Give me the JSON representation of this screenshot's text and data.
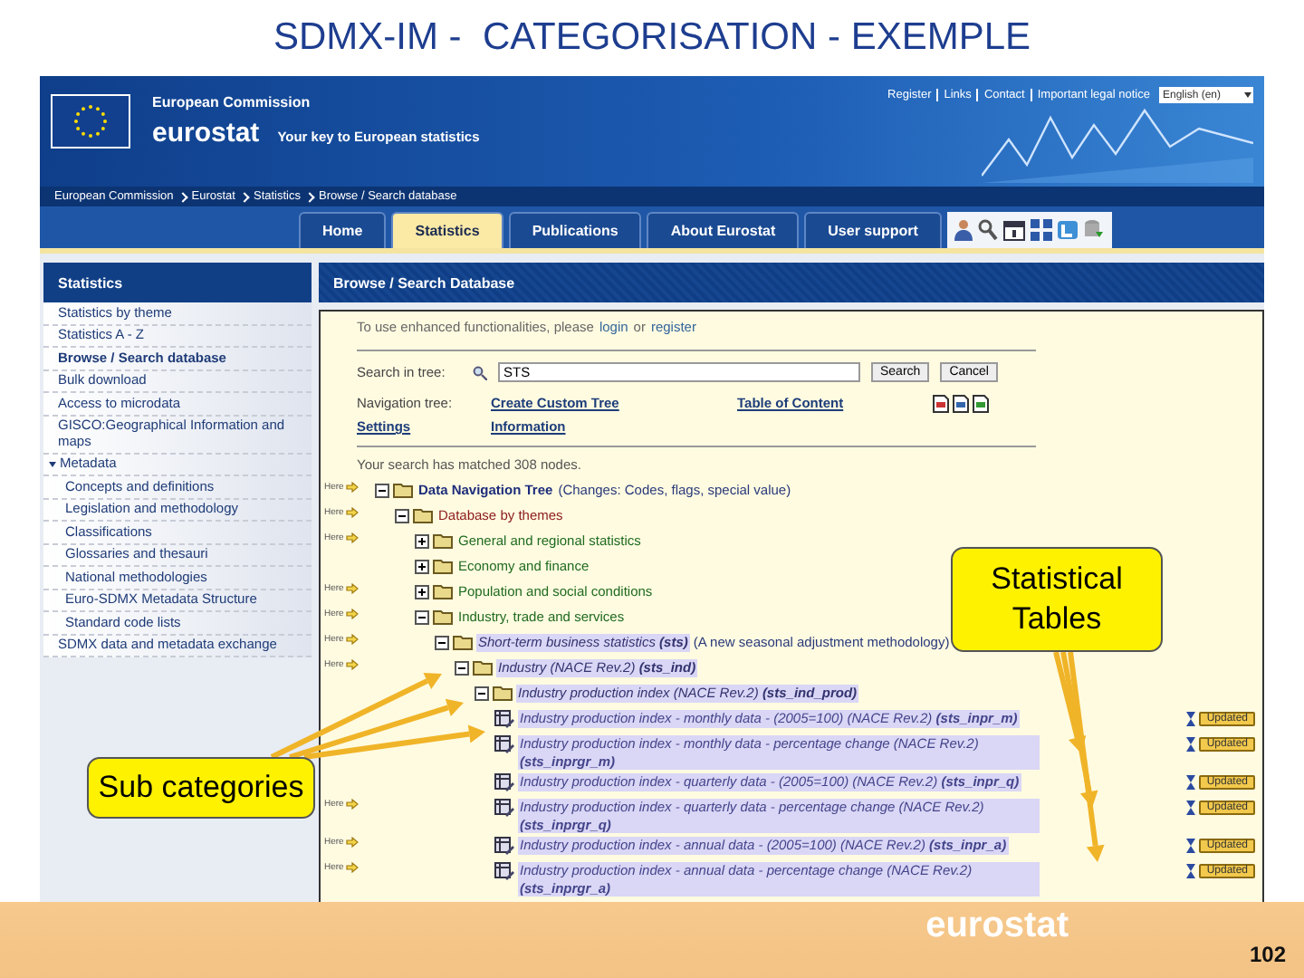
{
  "slide": {
    "title": "SDMX-IM -  CATEGORISATION - EXEMPLE",
    "page_number": "102",
    "footer_logo": "eurostat"
  },
  "site": {
    "top_links": [
      "Register",
      "Links",
      "Contact",
      "Important legal notice"
    ],
    "language": "English (en)",
    "org": "European Commission",
    "brand": "eurostat",
    "tagline": "Your key to European statistics",
    "breadcrumb": [
      "European Commission",
      "Eurostat",
      "Statistics",
      "Browse / Search database"
    ],
    "nav_tabs": [
      {
        "label": "Home",
        "selected": false
      },
      {
        "label": "Statistics",
        "selected": true
      },
      {
        "label": "Publications",
        "selected": false
      },
      {
        "label": "About Eurostat",
        "selected": false
      },
      {
        "label": "User support",
        "selected": false
      }
    ]
  },
  "sidebar": {
    "title": "Statistics",
    "items": [
      {
        "label": "Statistics by theme",
        "selected": false
      },
      {
        "label": "Statistics A - Z",
        "selected": false
      },
      {
        "label": "Browse / Search database",
        "selected": true
      },
      {
        "label": "Bulk download",
        "selected": false
      },
      {
        "label": "Access to microdata",
        "selected": false
      },
      {
        "label": "GISCO:Geographical Information and maps",
        "selected": false
      },
      {
        "label": "Metadata",
        "selected": false,
        "expanded": true,
        "children": [
          {
            "label": "Concepts and definitions",
            "selected": false
          },
          {
            "label": "Legislation and methodology",
            "selected": false
          },
          {
            "label": "Classifications",
            "selected": false
          },
          {
            "label": "Glossaries and thesauri",
            "selected": false
          },
          {
            "label": "National methodologies",
            "selected": false
          },
          {
            "label": "Euro-SDMX Metadata Structure",
            "selected": false
          },
          {
            "label": "Standard code lists",
            "selected": false
          }
        ]
      },
      {
        "label": "SDMX data and metadata exchange",
        "selected": false
      }
    ]
  },
  "main": {
    "title": "Browse / Search Database",
    "notice": [
      {
        "text": "To use enhanced functionalities, please",
        "link": false
      },
      {
        "text": "login",
        "link": true
      },
      {
        "text": "or",
        "link": false
      },
      {
        "text": "register",
        "link": true
      }
    ],
    "search": {
      "label": "Search in tree:",
      "value": "STS",
      "buttons": [
        "Search",
        "Cancel"
      ]
    },
    "navigation": {
      "label": "Navigation tree:",
      "links": [
        "Create Custom Tree",
        "Table of Content",
        "Settings",
        "Information"
      ]
    },
    "match_text": "Your search has matched 308 nodes.",
    "tree": [
      {
        "kind": "root",
        "label": "Data Navigation Tree",
        "note": "(Changes: Codes, flags, special value)",
        "here": "Here",
        "expanded": true,
        "highlighted": false,
        "children": [
          {
            "kind": "group",
            "label": "Database by themes",
            "here": "Here",
            "expanded": true,
            "highlighted": false,
            "children": [
              {
                "kind": "theme",
                "label": "General and regional statistics",
                "here": "Here",
                "expanded": false,
                "highlighted": false
              },
              {
                "kind": "theme",
                "label": "Economy and finance",
                "expanded": false,
                "highlighted": false
              },
              {
                "kind": "theme",
                "label": "Population and social conditions",
                "here": "Here",
                "expanded": false,
                "highlighted": false
              },
              {
                "kind": "theme",
                "label": "Industry, trade and services",
                "here": "Here",
                "expanded": true,
                "highlighted": false,
                "children": [
                  {
                    "kind": "folder",
                    "label": "Short-term business statistics",
                    "code": "(sts)",
                    "note": "(A new seasonal adjustment methodology)",
                    "here": "Here",
                    "expanded": true,
                    "highlighted": true,
                    "children": [
                      {
                        "kind": "folder",
                        "label": "Industry (NACE Rev.2)",
                        "code": "(sts_ind)",
                        "here": "Here",
                        "expanded": true,
                        "highlighted": true,
                        "children": [
                          {
                            "kind": "folder",
                            "label": "Industry production index (NACE Rev.2)",
                            "code": "(sts_ind_prod)",
                            "expanded": true,
                            "highlighted": true,
                            "children": [
                              {
                                "kind": "table",
                                "label": "Industry production index - monthly data - (2005=100) (NACE Rev.2)",
                                "code": "(sts_inpr_m)",
                                "highlighted": true,
                                "updated": "Updated"
                              },
                              {
                                "kind": "table",
                                "label": "Industry production index - monthly data - percentage change (NACE Rev.2)",
                                "code": "(sts_inprgr_m)",
                                "highlighted": true,
                                "updated": "Updated"
                              },
                              {
                                "kind": "table",
                                "label": "Industry production index - quarterly data - (2005=100) (NACE Rev.2)",
                                "code": "(sts_inpr_q)",
                                "highlighted": true,
                                "updated": "Updated"
                              },
                              {
                                "kind": "table",
                                "label": "Industry production index - quarterly data - percentage change (NACE Rev.2)",
                                "code": "(sts_inprgr_q)",
                                "here": "Here",
                                "highlighted": true,
                                "updated": "Updated"
                              },
                              {
                                "kind": "table",
                                "label": "Industry production index - annual data - (2005=100) (NACE Rev.2)",
                                "code": "(sts_inpr_a)",
                                "here": "Here",
                                "highlighted": true,
                                "updated": "Updated"
                              },
                              {
                                "kind": "table",
                                "label": "Industry production index - annual data - percentage change (NACE Rev.2)",
                                "code": "(sts_inprgr_a)",
                                "here": "Here",
                                "highlighted": true,
                                "updated": "Updated"
                              }
                            ]
                          }
                        ]
                      }
                    ]
                  }
                ]
              }
            ]
          }
        ]
      }
    ]
  },
  "annotations": [
    {
      "text": "Statistical Tables"
    },
    {
      "text": "Sub categories"
    }
  ]
}
